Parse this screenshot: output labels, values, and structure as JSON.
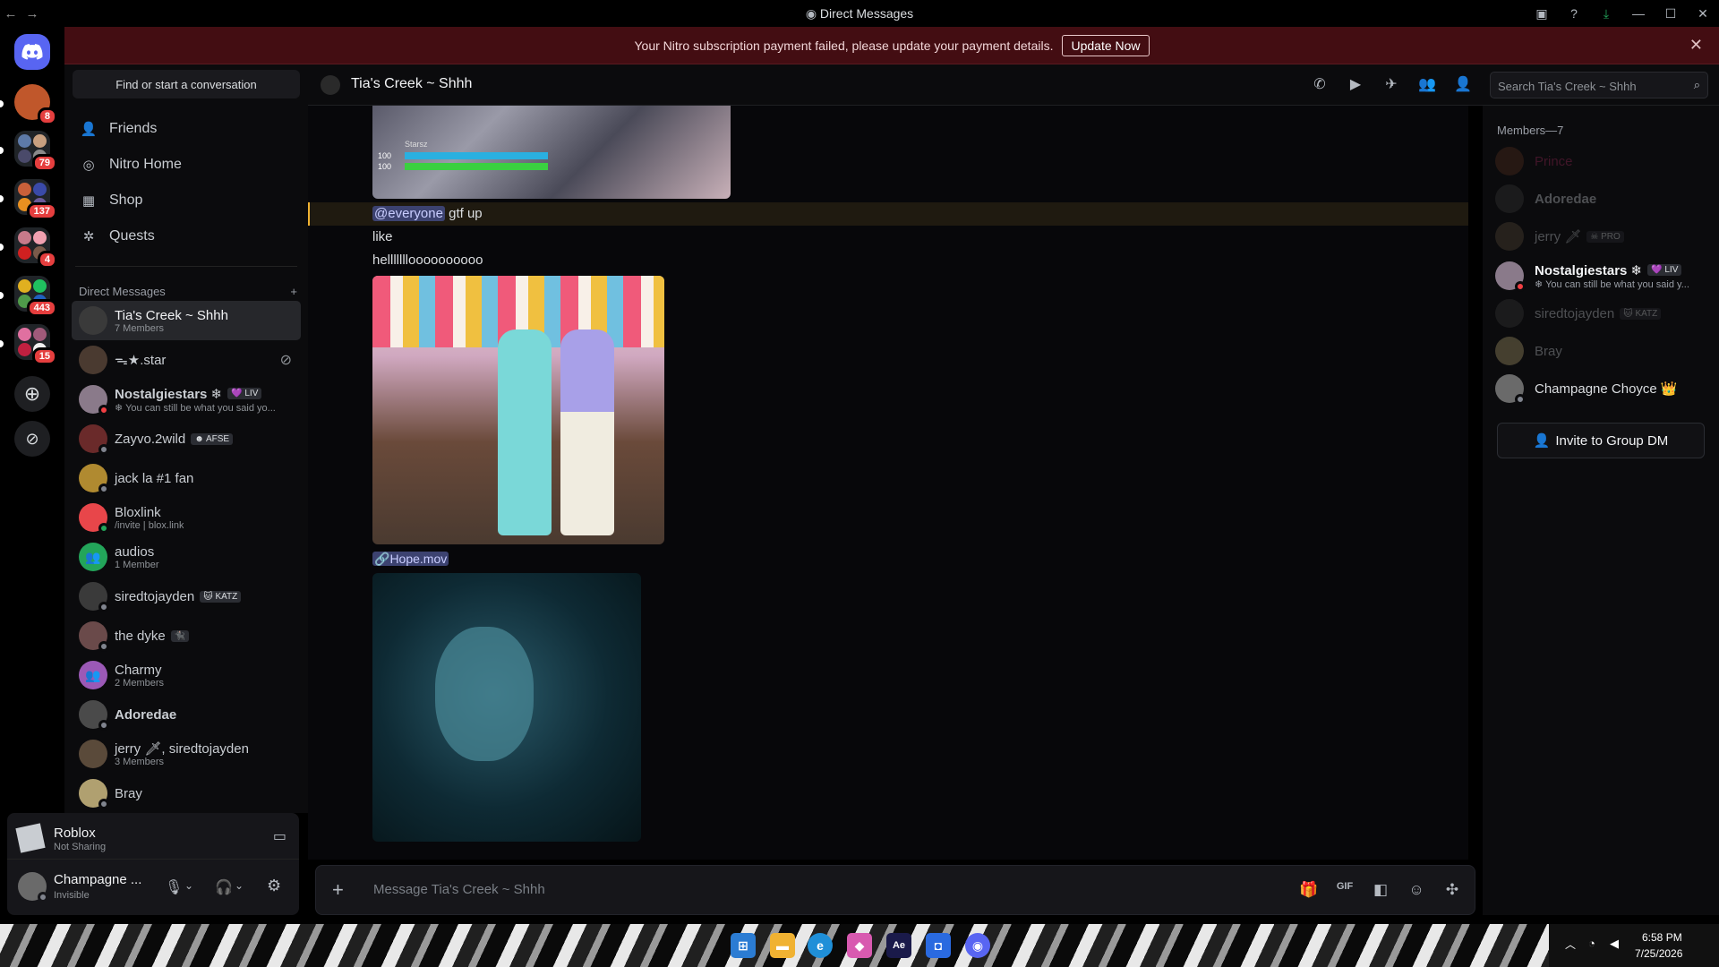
{
  "window": {
    "title": "Direct Messages",
    "back": "←",
    "forward": "→"
  },
  "banner": {
    "text": "Your Nitro subscription payment failed, please update your payment details.",
    "button": "Update Now"
  },
  "servers": [
    {
      "badge": "8",
      "color": "#c0572b"
    },
    {
      "badge": "79",
      "color": "#5d7aa8"
    },
    {
      "badge": "137",
      "color": "#6b5a9a"
    },
    {
      "badge": "4",
      "color": "#c77a8a"
    },
    {
      "badge": "443",
      "color": "#4f9a4a"
    },
    {
      "badge": "15",
      "color": "#a05a7a"
    }
  ],
  "sidebar": {
    "find": "Find or start a conversation",
    "nav": [
      {
        "label": "Friends",
        "icon": "friends-icon"
      },
      {
        "label": "Nitro Home",
        "icon": "nitro-icon"
      },
      {
        "label": "Shop",
        "icon": "shop-icon"
      },
      {
        "label": "Quests",
        "icon": "quests-icon"
      }
    ],
    "dm_header": "Direct Messages",
    "dms": [
      {
        "name": "Tia's Creek ~ Shhh",
        "sub": "7 Members",
        "color": "#3a3a3a",
        "status": ""
      },
      {
        "name": "ᯓ★.star",
        "sub": "",
        "color": "#4a3a30",
        "status": ""
      },
      {
        "name": "Nostalgiestars ❄",
        "tag": "💜 LIV",
        "sub": "❄ You can still be what you said yo...",
        "color": "#8a7a8a",
        "status": "#f23f43"
      },
      {
        "name": "Zayvo.2wild",
        "tag": "☻ AFSE",
        "sub": "",
        "color": "#6a2a2a",
        "status": "#80848e"
      },
      {
        "name": "jack la #1 fan",
        "sub": "",
        "color": "#b08a30",
        "status": "#80848e"
      },
      {
        "name": "Bloxlink",
        "sub": "/invite | blox.link",
        "color": "#e8464a",
        "status": "#23a55a"
      },
      {
        "name": "audios",
        "sub": "1 Member",
        "color": "#23a55a",
        "status": ""
      },
      {
        "name": "siredtojayden",
        "tag": "🐱 KATZ",
        "sub": "",
        "color": "#3a3a3a",
        "status": "#80848e"
      },
      {
        "name": "the dyke",
        "tag": "🐈‍⬛",
        "sub": "",
        "color": "#6a4a4a",
        "status": "#80848e"
      },
      {
        "name": "Charmy",
        "sub": "2 Members",
        "color": "#9b59b6",
        "status": ""
      },
      {
        "name": "Adoredae",
        "sub": "",
        "color": "#4a4a4a",
        "status": "#80848e"
      },
      {
        "name": "jerry 🗡, siredtojayden",
        "sub": "3 Members",
        "color": "#5a4a3a",
        "status": ""
      },
      {
        "name": "Bray",
        "sub": "",
        "color": "#b0a070",
        "status": "#80848e"
      }
    ]
  },
  "activity": {
    "title": "Roblox",
    "sub": "Not Sharing"
  },
  "user": {
    "name": "Champagne ...",
    "status": "Invisible"
  },
  "chat": {
    "title": "Tia's Creek ~ Shhh",
    "search_placeholder": "Search Tia's Creek ~ Shhh",
    "hud": {
      "label": "Starsz",
      "v1": "100",
      "v2": "100"
    },
    "messages": {
      "mention": "@everyone",
      "m1_rest": " gtf up",
      "m2": "like",
      "m3": "hellllllloooooooooo",
      "file": "Hope.mov"
    },
    "composer_placeholder": "Message Tia's Creek ~ Shhh"
  },
  "members": {
    "header": "Members—7",
    "list": [
      {
        "name": "Prince",
        "color": "#a3295a",
        "av": "#5a3020",
        "dim": true
      },
      {
        "name": "Adoredae",
        "color": "#72767d",
        "av": "#3a3a3a",
        "dim": true
      },
      {
        "name": "jerry 🗡",
        "tag": "☠ PRO",
        "color": "#72767d",
        "av": "#5a4a3a",
        "dim": true
      },
      {
        "name": "Nostalgiestars ❄",
        "tag": "💜 LIV",
        "sub": "❄ You can still be what you said y...",
        "color": "#f2f3f5",
        "av": "#8a7a8a",
        "dim": false
      },
      {
        "name": "siredtojayden",
        "tag": "🐱 KATZ",
        "color": "#72767d",
        "av": "#3a3a3a",
        "dim": true
      },
      {
        "name": "Bray",
        "color": "#72767d",
        "av": "#b0a070",
        "dim": true
      },
      {
        "name": "Champagne Choyce 👑",
        "color": "#dbdee1",
        "av": "#6a6a6a",
        "dim": false
      }
    ],
    "invite": "Invite to Group DM"
  },
  "tray": {
    "time": "6:58 PM",
    "date": "7/25/2026"
  }
}
